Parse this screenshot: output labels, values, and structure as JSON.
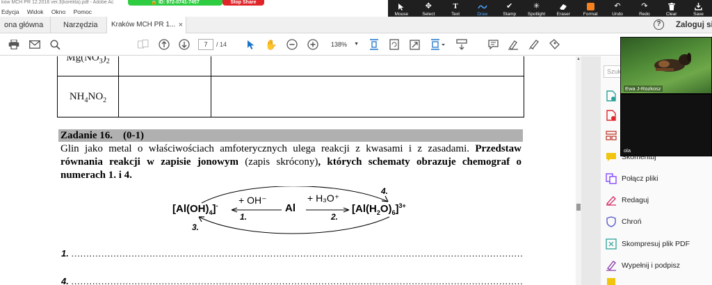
{
  "window": {
    "title": "kow MCH PR 12.2016 ver.3(korekta).pdf - Adobe Ac",
    "menu": [
      "Edycja",
      "Widok",
      "Okno",
      "Pomoc"
    ]
  },
  "zoom_share": {
    "id_label": "ID: 972-0741-7457",
    "stop_label": "Stop Share"
  },
  "annotation_toolbar": {
    "items": [
      {
        "label": "Mouse",
        "icon": "cursor-icon"
      },
      {
        "label": "Select",
        "icon": "move-icon"
      },
      {
        "label": "Text",
        "icon": "text-icon"
      },
      {
        "label": "Draw",
        "icon": "draw-icon",
        "active": true
      },
      {
        "label": "Stamp",
        "icon": "stamp-icon"
      },
      {
        "label": "Spotlight",
        "icon": "spotlight-icon"
      },
      {
        "label": "Eraser",
        "icon": "eraser-icon"
      },
      {
        "label": "Format",
        "icon": "format-icon"
      },
      {
        "label": "Undo",
        "icon": "undo-icon"
      },
      {
        "label": "Redo",
        "icon": "redo-icon"
      },
      {
        "label": "Clear",
        "icon": "trash-icon"
      },
      {
        "label": "Save",
        "icon": "save-icon"
      }
    ],
    "format_color": "#f5821f"
  },
  "tabs": {
    "home": "ona główna",
    "tools": "Narzędzia",
    "document": "Kraków MCH PR 1...",
    "login": "Zaloguj si"
  },
  "toolbar": {
    "page_current": "7",
    "page_total": "/ 14",
    "zoom": "138%"
  },
  "document": {
    "table_rows": [
      {
        "formula_html": "Mg(NO<sub>3</sub>)<sub>2</sub>"
      },
      {
        "formula_html": "NH<sub>4</sub>NO<sub>2</sub>"
      }
    ],
    "task_title": "Zadanie 16.    (0-1)",
    "task_text_1": "Glin jako metal o właściwościach amfoterycznych ulega reakcji z kwasami i z zasadami.",
    "task_bold_1": "Przedstaw równania reakcji w zapisie jonowym",
    "task_text_2": " (zapis skrócony)",
    "task_bold_2": ", których schematy obrazuje chemograf o numerach 1. i 4.",
    "chemograph": {
      "left_species": "[Al(OH)4]-",
      "center_species": "Al",
      "right_species": "[Al(H2O)6]3+",
      "reagent_left": "+ OH⁻",
      "reagent_right": "+ H₃O⁺",
      "labels": [
        "1.",
        "2.",
        "3.",
        "4."
      ]
    },
    "answers": [
      {
        "number": "1.",
        "dots": "……………………………………………………………………………………………………………………………………………………………………………"
      },
      {
        "number": "4.",
        "dots": "……………………………………………………………………………………………………………………………………………………………………………"
      }
    ]
  },
  "right_panel": {
    "search_placeholder": "Szuk",
    "items": [
      {
        "label": "",
        "icon": "export-pdf-icon",
        "color": "#2aa198"
      },
      {
        "label": "",
        "icon": "create-pdf-icon",
        "color": "#e0242a"
      },
      {
        "label": "",
        "icon": "organize-pages-icon",
        "color": "#c0392b"
      },
      {
        "label": "Skomentuj",
        "icon": "comment-icon",
        "color": "#f1c40f"
      },
      {
        "label": "Połącz pliki",
        "icon": "combine-files-icon",
        "color": "#7d3cff"
      },
      {
        "label": "Redaguj",
        "icon": "edit-icon",
        "color": "#d6336c"
      },
      {
        "label": "Chroń",
        "icon": "shield-icon",
        "color": "#5b5fc7"
      },
      {
        "label": "Skompresuj plik PDF",
        "icon": "compress-icon",
        "color": "#2aa198"
      },
      {
        "label": "Wypełnij i podpisz",
        "icon": "sign-icon",
        "color": "#8e44ad"
      },
      {
        "label": "",
        "icon": "more-tools-icon",
        "color": "#f1c40f"
      }
    ]
  },
  "video": {
    "participant_1": "Ewa J-Rozkosz",
    "participant_2": "ola"
  }
}
